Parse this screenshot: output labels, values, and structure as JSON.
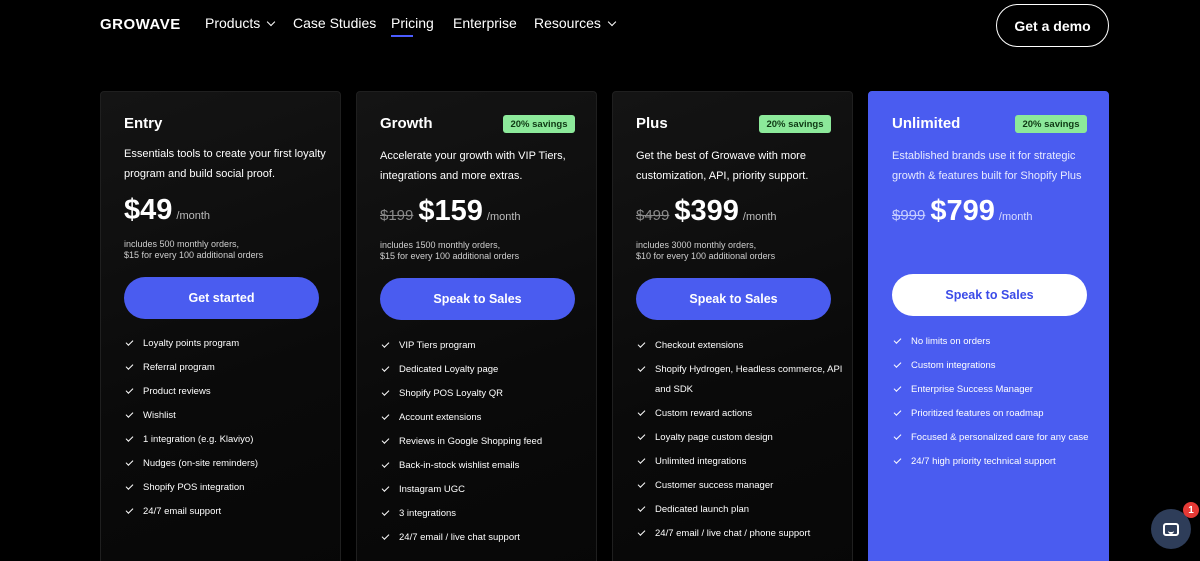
{
  "nav": {
    "logo": "GROWAVE",
    "items": [
      {
        "label": "Products",
        "dropdown": true
      },
      {
        "label": "Case Studies",
        "dropdown": false
      },
      {
        "label": "Pricing",
        "dropdown": false,
        "active": true
      },
      {
        "label": "Enterprise",
        "dropdown": false
      },
      {
        "label": "Resources",
        "dropdown": true
      }
    ],
    "demo_label": "Get a demo"
  },
  "plans": [
    {
      "name": "Entry",
      "savings": "",
      "description": "Essentials tools to create your first loyalty program and build social proof.",
      "old_price": "",
      "price": "$49",
      "period": "/month",
      "orders_line1": "includes 500 monthly orders,",
      "orders_line2": "$15 for every 100 additional orders",
      "cta": "Get started",
      "features": [
        "Loyalty points program",
        "Referral program",
        "Product reviews",
        "Wishlist",
        "1 integration (e.g. Klaviyo)",
        "Nudges (on-site reminders)",
        "Shopify POS integration",
        "24/7 email support"
      ]
    },
    {
      "name": "Growth",
      "savings": "20% savings",
      "description": "Accelerate your growth with VIP Tiers, integrations and more extras.",
      "old_price": "$199",
      "price": "$159",
      "period": "/month",
      "orders_line1": "includes 1500 monthly orders,",
      "orders_line2": "$15 for every 100 additional orders",
      "cta": "Speak to Sales",
      "features": [
        "VIP Tiers program",
        "Dedicated Loyalty page",
        "Shopify POS Loyalty QR",
        "Account extensions",
        "Reviews in Google Shopping feed",
        "Back-in-stock wishlist emails",
        "Instagram UGC",
        "3 integrations",
        "24/7 email / live chat support"
      ]
    },
    {
      "name": "Plus",
      "savings": "20% savings",
      "description": "Get the best of Growave with more customization, API, priority support.",
      "old_price": "$499",
      "price": "$399",
      "period": "/month",
      "orders_line1": "includes 3000 monthly orders,",
      "orders_line2": "$10 for every 100 additional orders",
      "cta": "Speak to Sales",
      "features": [
        "Checkout extensions",
        "Shopify Hydrogen, Headless commerce, API and SDK",
        "Custom reward actions",
        "Loyalty page custom design",
        "Unlimited integrations",
        "Customer success manager",
        "Dedicated launch plan",
        "24/7 email / live chat / phone support"
      ]
    },
    {
      "name": "Unlimited",
      "savings": "20% savings",
      "description": "Established brands use it for strategic growth & features built for Shopify Plus",
      "old_price": "$999",
      "price": "$799",
      "period": "/month",
      "orders_line1": "",
      "orders_line2": "",
      "cta": "Speak to Sales",
      "features": [
        "No limits on orders",
        "Custom integrations",
        "Enterprise Success Manager",
        "Prioritized features on roadmap",
        "Focused & personalized care for any case",
        "24/7 high priority technical support"
      ]
    }
  ],
  "chat": {
    "badge": "1"
  },
  "colors": {
    "accent": "#4a5cf0",
    "savings_bg": "#8ce99a",
    "background": "#000000"
  }
}
